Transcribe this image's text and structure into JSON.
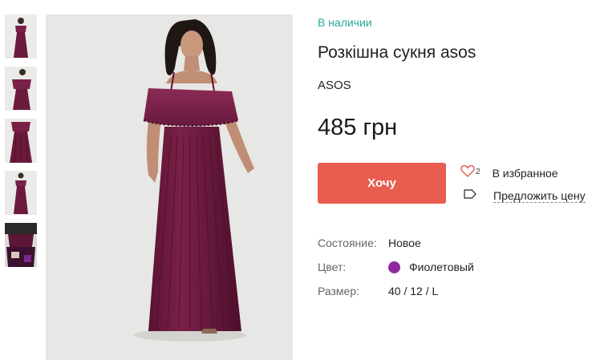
{
  "gallery": {
    "thumbnails": [
      {
        "alt": "thumbnail-1"
      },
      {
        "alt": "thumbnail-2"
      },
      {
        "alt": "thumbnail-3"
      },
      {
        "alt": "thumbnail-4"
      },
      {
        "alt": "thumbnail-5"
      }
    ],
    "dress_color": "#6b1a3c",
    "background_color": "#e7e7e5"
  },
  "product": {
    "availability": "В наличии",
    "title": "Розкішна сукня asos",
    "brand": "ASOS",
    "price": "485 грн"
  },
  "actions": {
    "want_label": "Хочу",
    "favorite_count": "2",
    "favorite_label": "В избранное",
    "offer_label": "Предложить цену"
  },
  "specs": {
    "condition_key": "Состояние:",
    "condition_value": "Новое",
    "color_key": "Цвет:",
    "color_value": "Фиолетовый",
    "color_swatch": "#8e2a9e",
    "size_key": "Размер:",
    "size_value": "40 / 12 / L"
  },
  "colors": {
    "accent": "#e85d50",
    "stock_text": "#2aa69a"
  },
  "icons": {
    "heart": "heart-icon",
    "tag": "price-tag-icon"
  }
}
